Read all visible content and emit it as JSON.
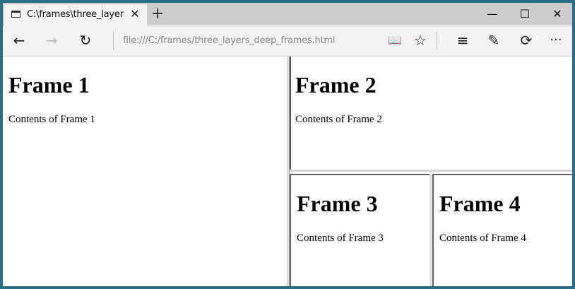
{
  "tab": {
    "title": "C:\\frames\\three_layers_c",
    "close_icon": "close-icon",
    "page_icon": "page-icon"
  },
  "newtab": {
    "label": "+"
  },
  "window_controls": {
    "minimize": "—",
    "maximize": "☐",
    "close": "✕"
  },
  "toolbar": {
    "back": "←",
    "forward": "→",
    "refresh": "↻",
    "reading_view": "📖",
    "favorite": "☆",
    "hub": "≡",
    "web_note": "✎",
    "share": "⟳",
    "more": "···"
  },
  "address": {
    "value": "file:///C:/frames/three_layers_deep_frames.html"
  },
  "frames": [
    {
      "heading": "Frame 1",
      "text": "Contents of Frame 1"
    },
    {
      "heading": "Frame 2",
      "text": "Contents of Frame 2"
    },
    {
      "heading": "Frame 3",
      "text": "Contents of Frame 3"
    },
    {
      "heading": "Frame 4",
      "text": "Contents of Frame 4"
    }
  ],
  "colors": {
    "window_border": "#2b6f86",
    "titlebar": "#cccccc",
    "toolbar": "#f2f2f2"
  }
}
